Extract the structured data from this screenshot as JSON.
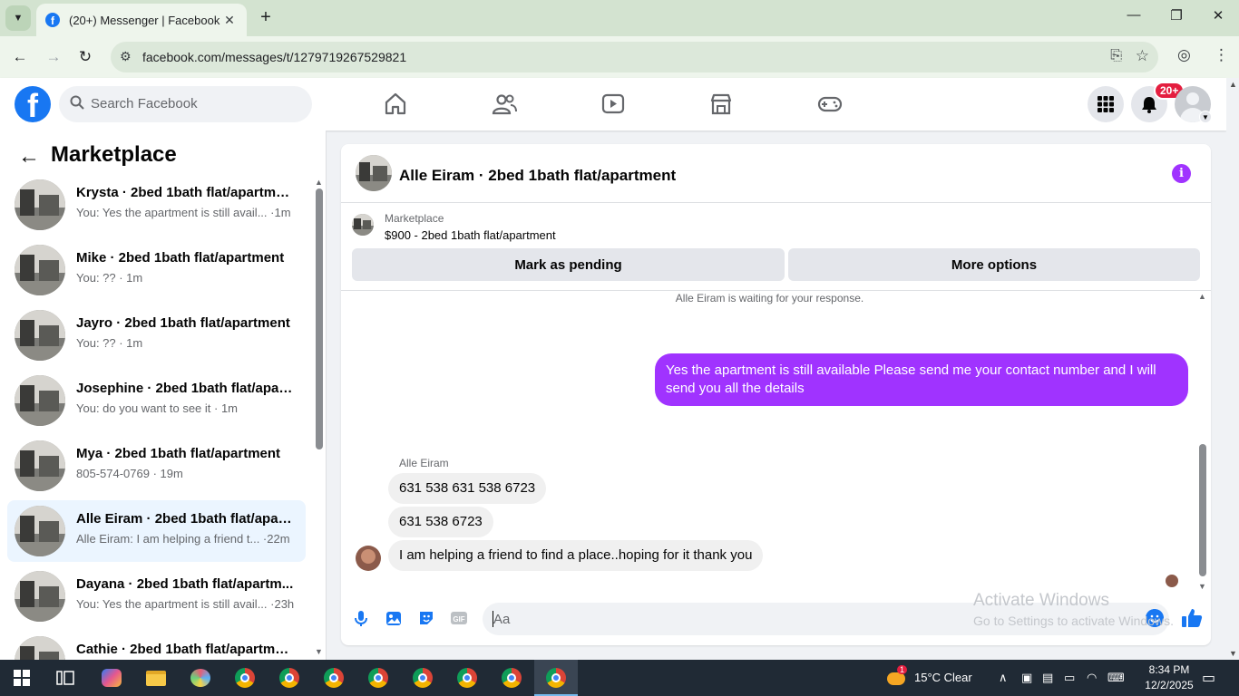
{
  "browser": {
    "tab_title": "(20+) Messenger | Facebook",
    "url": "facebook.com/messages/t/1279719267529821"
  },
  "header": {
    "search_placeholder": "Search Facebook",
    "notification_badge": "20+",
    "brand_color": "#1877f2"
  },
  "sidebar": {
    "title": "Marketplace",
    "conversations": [
      {
        "name": "Krysta · 2bed 1bath flat/apartme...",
        "preview": "You: Yes the apartment is still avail... ·1m",
        "active": false
      },
      {
        "name": "Mike · 2bed 1bath flat/apartment",
        "preview": "You: ?? · 1m",
        "active": false
      },
      {
        "name": "Jayro · 2bed 1bath flat/apartment",
        "preview": "You: ?? · 1m",
        "active": false
      },
      {
        "name": "Josephine · 2bed 1bath flat/apar...",
        "preview": "You: do you want to see it · 1m",
        "active": false
      },
      {
        "name": "Mya · 2bed 1bath flat/apartment",
        "preview": "805-574-0769 · 19m",
        "active": false
      },
      {
        "name": "Alle Eiram · 2bed 1bath flat/apar...",
        "preview": "Alle Eiram: I am helping a friend t... ·22m",
        "active": true
      },
      {
        "name": "Dayana · 2bed 1bath flat/apartm...",
        "preview": "You: Yes the apartment is still avail... ·23h",
        "active": false
      },
      {
        "name": "Cathie · 2bed 1bath flat/apartme...",
        "preview": "",
        "active": false
      }
    ]
  },
  "chat": {
    "title": "Alle Eiram · 2bed 1bath flat/apartment",
    "listing_label": "Marketplace",
    "listing_price": "$900 - 2bed 1bath flat/apartment",
    "mark_pending_label": "Mark as pending",
    "more_options_label": "More options",
    "waiting_text": "Alle Eiram is waiting for your response.",
    "outgoing_message": "Yes the apartment is still available Please send me your contact number and I will send you all the details",
    "sender_name": "Alle Eiram",
    "incoming_messages": [
      "631 538 631 538 6723",
      "631 538 6723",
      "I am helping a friend to find a place..hoping for it thank you"
    ],
    "composer_placeholder": "Aa",
    "accent_color": "#a033ff"
  },
  "watermark": {
    "line1": "Activate Windows",
    "line2": "Go to Settings to activate Windows."
  },
  "taskbar": {
    "weather": "15°C  Clear",
    "time": "8:34 PM",
    "date": "12/2/2025",
    "weather_badge": "1"
  }
}
